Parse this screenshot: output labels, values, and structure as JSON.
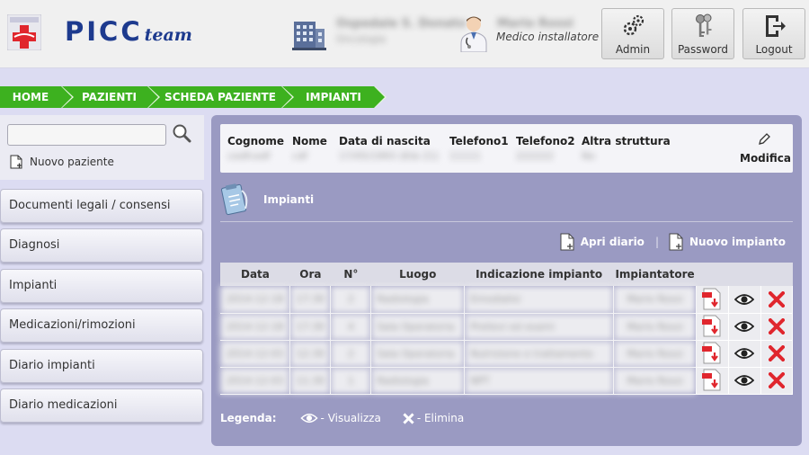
{
  "header": {
    "brand": {
      "main": "PICC",
      "sub": "team"
    },
    "facility": {
      "name": "Ospedale S. Donato",
      "department": "Oncologia"
    },
    "user": {
      "name": "Mario Rossi",
      "role": "Medico installatore"
    },
    "buttons": {
      "admin": "Admin",
      "password": "Password",
      "logout": "Logout"
    }
  },
  "breadcrumb": [
    "HOME",
    "PAZIENTI",
    "SCHEDA PAZIENTE",
    "IMPIANTI"
  ],
  "sidebar": {
    "search": {
      "value": "",
      "placeholder": ""
    },
    "new_patient": "Nuovo paziente",
    "items": [
      {
        "label": "Documenti legali / consensi"
      },
      {
        "label": "Diagnosi"
      },
      {
        "label": "Impianti"
      },
      {
        "label": "Medicazioni/rimozioni"
      },
      {
        "label": "Diario impianti"
      },
      {
        "label": "Diario medicazioni"
      }
    ]
  },
  "patient": {
    "labels": [
      "Cognome",
      "Nome",
      "Data di nascita",
      "Telefono1",
      "Telefono2",
      "Altra struttura"
    ],
    "values": [
      "cedfcedf",
      "cdf",
      "17/05/1993 (Età 21)",
      "11111",
      "222222",
      "No"
    ],
    "edit_label": "Modifica"
  },
  "section": {
    "title": "Impianti"
  },
  "actions": {
    "open_diary": "Apri diario",
    "new_implant": "Nuovo impianto",
    "separator": "|"
  },
  "table": {
    "headers": [
      "Data",
      "Ora",
      "N°",
      "Luogo",
      "Indicazione impianto",
      "Impiantatore"
    ],
    "rows": [
      [
        "2014-12-18",
        "17:30",
        "2",
        "Radiologia",
        "Emodialisi",
        "Mario Rossi"
      ],
      [
        "2014-12-18",
        "17:30",
        "4",
        "Sala Operatoria",
        "Prelievi ed esami",
        "Mario Rossi"
      ],
      [
        "2014-12-03",
        "12:30",
        "2",
        "Sala Operatoria",
        "Nutrizione e trattamento",
        "Mario Rossi"
      ],
      [
        "2014-12-03",
        "11:30",
        "1",
        "Radiologia",
        "NPT",
        "Mario Rossi"
      ]
    ]
  },
  "legend": {
    "title": "Legenda:",
    "view": "- Visualizza",
    "delete": "- Elimina"
  },
  "colors": {
    "breadcrumb": "#3db11f",
    "panel": "#9a9ac2",
    "delete": "#e0262d",
    "brand": "#1d3a8e"
  }
}
